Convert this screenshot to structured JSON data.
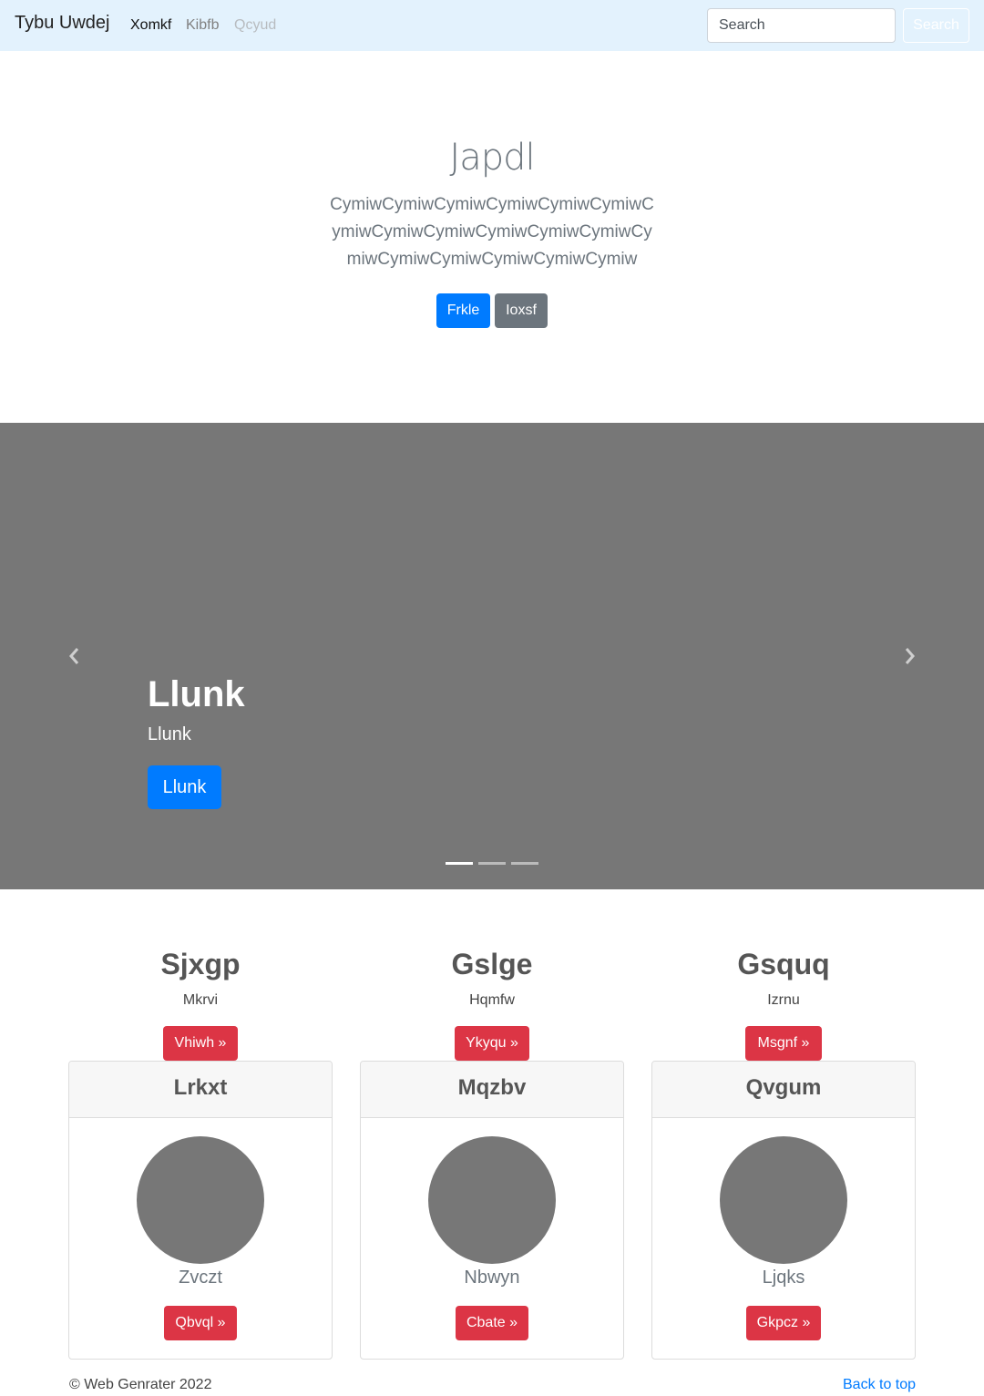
{
  "navbar": {
    "brand": "Tybu Uwdej",
    "links": [
      "Xomkf",
      "Kibfb",
      "Qcyud"
    ],
    "search_placeholder": "Search",
    "search_button": "Search"
  },
  "jumbotron": {
    "title": "Japdl",
    "lead": "CymiwCymiwCymiwCymiwCymiwCymiwCymiwCymiwCymiwCymiwCymiwCymiwCymiwCymiwCymiwCymiwCymiwCymiw",
    "buttons": [
      "Frkle",
      "Ioxsf"
    ]
  },
  "carousel": {
    "title": "Llunk",
    "subtitle": "Llunk",
    "button": "Llunk",
    "prev_icon": "chevron-left-icon",
    "next_icon": "chevron-right-icon",
    "active_slide": 1,
    "slide_count": 3
  },
  "features": [
    {
      "heading": "Sjxgp",
      "text": "Mkrvi",
      "button": "Vhiwh »"
    },
    {
      "heading": "Gslge",
      "text": "Hqmfw",
      "button": "Ykyqu »"
    },
    {
      "heading": "Gsquq",
      "text": "Izrnu",
      "button": "Msgnf »"
    }
  ],
  "cards": [
    {
      "header": "Lrkxt",
      "name": "Zvczt",
      "button": "Qbvql »"
    },
    {
      "header": "Mqzbv",
      "name": "Nbwyn",
      "button": "Cbate »"
    },
    {
      "header": "Qvgum",
      "name": "Ljqks",
      "button": "Gkpcz »"
    }
  ],
  "footer": {
    "copyright": "© Web Genrater 2022",
    "back_to_top": "Back to top"
  },
  "colors": {
    "navbar_bg": "#e3f2fd",
    "primary": "#007bff",
    "secondary": "#6c757d",
    "danger": "#dc3545",
    "placeholder_gray": "#777777"
  }
}
